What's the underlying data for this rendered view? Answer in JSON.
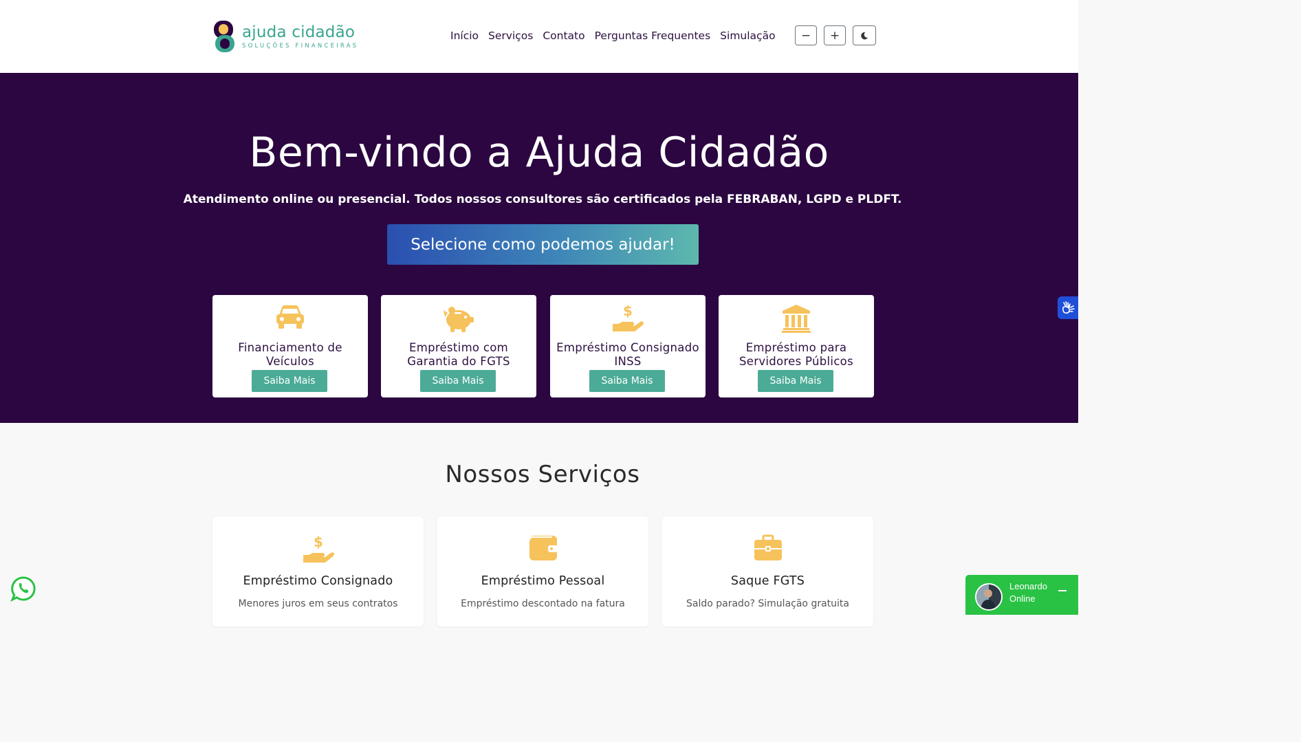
{
  "header": {
    "logo_name": "ajuda cidadão",
    "logo_tagline": "SOLUÇÕES FINANCEIRAS",
    "nav": [
      {
        "label": "Início"
      },
      {
        "label": "Serviços"
      },
      {
        "label": "Contato"
      },
      {
        "label": "Perguntas Frequentes"
      },
      {
        "label": "Simulação"
      }
    ],
    "controls": {
      "font_decrease": "−",
      "font_increase": "+",
      "dark_mode_icon": "moon-icon"
    }
  },
  "hero": {
    "title": "Bem-vindo a Ajuda Cidadão",
    "subtitle": "Atendimento online ou presencial. Todos nossos consultores são certificados pela FEBRABAN, LGPD e PLDFT.",
    "cta": "Selecione como podemos ajudar!",
    "cards": [
      {
        "icon": "car-icon",
        "title": "Financiamento de Veículos",
        "button": "Saiba Mais"
      },
      {
        "icon": "piggy-bank-icon",
        "title": "Empréstimo com Garantia do FGTS",
        "button": "Saiba Mais"
      },
      {
        "icon": "hand-dollar-icon",
        "title": "Empréstimo Consignado INSS",
        "button": "Saiba Mais"
      },
      {
        "icon": "bank-building-icon",
        "title": "Empréstimo para Servidores Públicos",
        "button": "Saiba Mais"
      }
    ]
  },
  "services": {
    "title": "Nossos Serviços",
    "items": [
      {
        "icon": "hand-dollar-icon",
        "title": "Empréstimo Consignado",
        "desc": "Menores juros em seus contratos"
      },
      {
        "icon": "wallet-icon",
        "title": "Empréstimo Pessoal",
        "desc": "Empréstimo descontado na fatura"
      },
      {
        "icon": "briefcase-icon",
        "title": "Saque FGTS",
        "desc": "Saldo parado? Simulação gratuita"
      }
    ]
  },
  "chat": {
    "name": "Leonardo",
    "status": "Online"
  },
  "colors": {
    "hero_bg": "#2b0640",
    "accent_green": "#4cab96",
    "icon_yellow": "#f6c25b",
    "nav_text": "#2d1040",
    "chat_green": "#29c245"
  }
}
